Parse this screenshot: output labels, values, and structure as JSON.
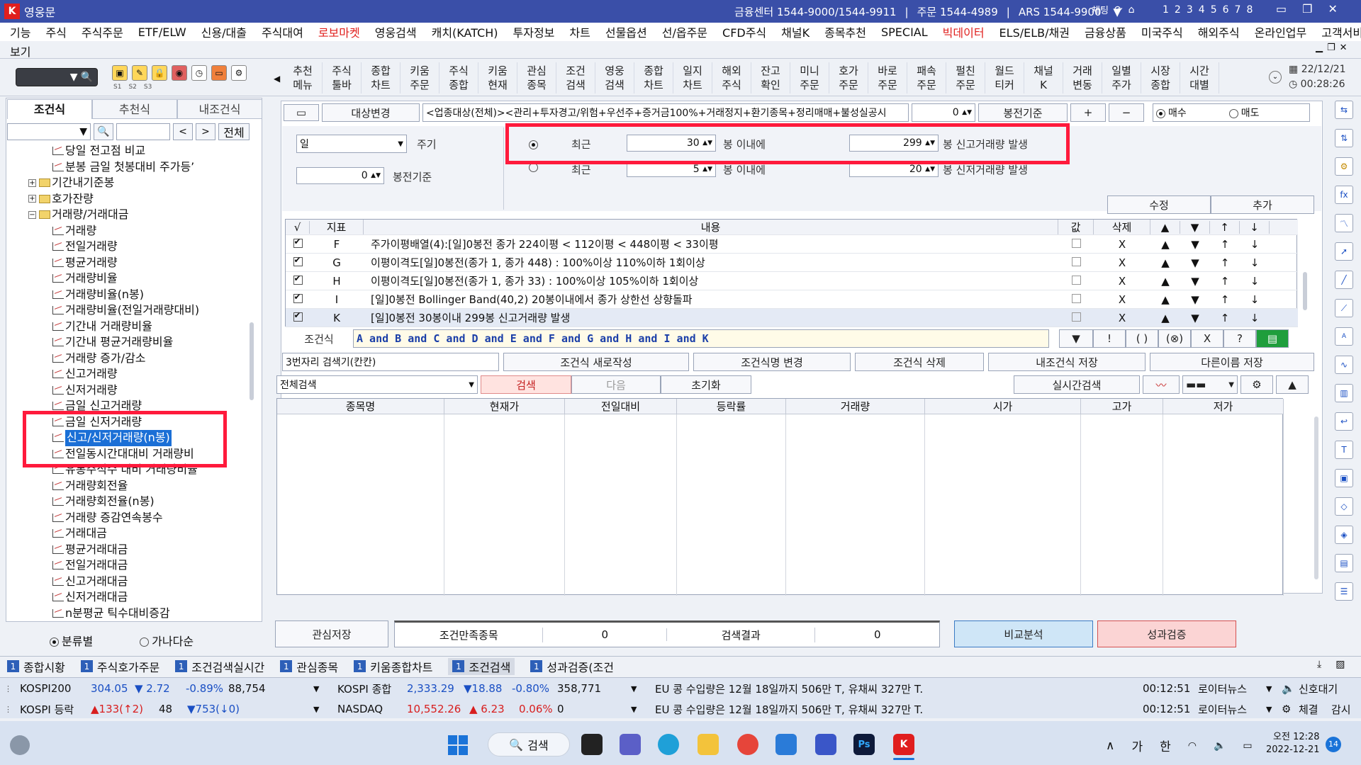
{
  "window": {
    "app_title": "영웅문",
    "info": [
      "금융센터 1544-9000/1544-9911",
      "|",
      "주문 1544-4989",
      "|",
      "ARS 1544-9900"
    ],
    "chat_label": "채팅",
    "screen_nums": [
      "1",
      "2",
      "3",
      "4",
      "5",
      "6",
      "7",
      "8"
    ]
  },
  "menu": [
    "기능",
    "주식",
    "주식주문",
    "ETF/ELW",
    "신용/대출",
    "주식대여",
    "로보마켓",
    "영웅검색",
    "캐치(KATCH)",
    "투자정보",
    "차트",
    "선물옵션",
    "선/옵주문",
    "CFD주식",
    "채널K",
    "종목추천",
    "SPECIAL",
    "빅데이터",
    "ELS/ELB/채권",
    "금융상품",
    "미국주식",
    "해외주식",
    "온라인업무",
    "고객서비스"
  ],
  "menu_red": [
    "로보마켓",
    "빅데이터"
  ],
  "menu_second": "보기",
  "toolbar": {
    "sub_labels": [
      "S1",
      "S2",
      "S3"
    ],
    "grid": [
      "추천\n메뉴",
      "주식\n툴바",
      "종합\n차트",
      "키움\n주문",
      "주식\n종합",
      "키움\n현재",
      "관심\n종목",
      "조건\n검색",
      "영웅\n검색",
      "종합\n차트",
      "일지\n차트",
      "해외\n주식",
      "잔고\n확인",
      "미니\n주문",
      "호가\n주문",
      "바로\n주문",
      "패속\n주문",
      "펄친\n주문",
      "월드\n티커",
      "채널\nK",
      "거래\n변동",
      "일별\n주가",
      "시장\n종합",
      "시간\n대별"
    ],
    "date": "22/12/21",
    "time": "00:28:26"
  },
  "left": {
    "tabs": [
      "조건식",
      "추천식",
      "내조건식"
    ],
    "all_button": "전체",
    "tree": [
      {
        "type": "item",
        "label": "당일 전고점 비교",
        "indent": 2
      },
      {
        "type": "item",
        "label": "분봉 금일 첫봉대비 주가등’",
        "indent": 2
      },
      {
        "type": "folder",
        "label": "기간내기준봉",
        "pm": "+",
        "indent": 0
      },
      {
        "type": "folder",
        "label": "호가잔량",
        "pm": "+",
        "indent": 0
      },
      {
        "type": "folder",
        "label": "거래량/거래대금",
        "pm": "−",
        "indent": 0
      },
      {
        "type": "item",
        "label": "거래량",
        "indent": 2
      },
      {
        "type": "item",
        "label": "전일거래량",
        "indent": 2
      },
      {
        "type": "item",
        "label": "평균거래량",
        "indent": 2
      },
      {
        "type": "item",
        "label": "거래량비율",
        "indent": 2
      },
      {
        "type": "item",
        "label": "거래량비율(n봉)",
        "indent": 2
      },
      {
        "type": "item",
        "label": "거래량비율(전일거래량대비)",
        "indent": 2
      },
      {
        "type": "item",
        "label": "기간내 거래량비율",
        "indent": 2
      },
      {
        "type": "item",
        "label": "기간내 평균거래량비율",
        "indent": 2
      },
      {
        "type": "item",
        "label": "거래량 증가/감소",
        "indent": 2
      },
      {
        "type": "item",
        "label": "신고거래량",
        "indent": 2
      },
      {
        "type": "item",
        "label": "신저거래량",
        "indent": 2
      },
      {
        "type": "item",
        "label": "금일 신고거래량",
        "indent": 2
      },
      {
        "type": "item",
        "label": "금일 신저거래량",
        "indent": 2
      },
      {
        "type": "item",
        "label": "신고/신저거래량(n봉)",
        "indent": 2,
        "selected": true
      },
      {
        "type": "item",
        "label": "전일동시간대대비 거래량비",
        "indent": 2
      },
      {
        "type": "item",
        "label": "유통주식수 대비 거래량비율",
        "indent": 2
      },
      {
        "type": "item",
        "label": "거래량회전율",
        "indent": 2
      },
      {
        "type": "item",
        "label": "거래량회전율(n봉)",
        "indent": 2
      },
      {
        "type": "item",
        "label": "거래량 증감연속봉수",
        "indent": 2
      },
      {
        "type": "item",
        "label": "거래대금",
        "indent": 2
      },
      {
        "type": "item",
        "label": "평균거래대금",
        "indent": 2
      },
      {
        "type": "item",
        "label": "전일거래대금",
        "indent": 2
      },
      {
        "type": "item",
        "label": "신고거래대금",
        "indent": 2
      },
      {
        "type": "item",
        "label": "신저거래대금",
        "indent": 2
      },
      {
        "type": "item",
        "label": "n분평균 틱수대비증감",
        "indent": 2
      }
    ],
    "radio_a": "분류별",
    "radio_b": "가나다순"
  },
  "cond": {
    "target_button": "대상변경",
    "target_text": "<업종대상(전체)><관리+투자경고/위험+우선주+증거금100%+거래정지+환기종목+정리매매+불성실공시",
    "num": "0",
    "bong_label": "봉전기준",
    "plus": "+",
    "minus": "−",
    "buy": "매수",
    "sell": "매도",
    "period_value": "일",
    "period_label": "주기",
    "bong_base_value": "0",
    "bong_base_label": "봉전기준",
    "row1": {
      "label": "최근",
      "n": "30",
      "mid": "봉 이내에",
      "m": "299",
      "tail": "봉 신고거래량 발생"
    },
    "row2": {
      "label": "최근",
      "n": "5",
      "mid": "봉 이내에",
      "m": "20",
      "tail": "봉 신저거래량 발생"
    },
    "edit": "수정",
    "add": "추가"
  },
  "table": {
    "headers": [
      "√",
      "지표",
      "내용",
      "값",
      "삭제",
      "▲",
      "▼",
      "↑",
      "↓"
    ],
    "rows": [
      {
        "id": "F",
        "content": "주가이평배열(4):[일]0봉전 종가 224이평 < 112이평 < 448이평 < 33이평"
      },
      {
        "id": "G",
        "content": "이평이격도[일]0봉전(종가 1, 종가 448) : 100%이상 110%이하 1회이상"
      },
      {
        "id": "H",
        "content": "이평이격도[일]0봉전(종가 1, 종가 33) : 100%이상 105%이하 1회이상"
      },
      {
        "id": "I",
        "content": "[일]0봉전 Bollinger Band(40,2) 20봉이내에서 종가 상한선 상향돌파"
      },
      {
        "id": "K",
        "content": "[일]0봉전 30봉이내 299봉 신고거래량 발생"
      }
    ],
    "del": "X",
    "up": "▲",
    "down": "▼",
    "top": "↑",
    "bottom": "↓",
    "formula_label": "조건식",
    "formula": "A and B and C and D and E and F and G and H and I and K",
    "formula_btns": [
      "▼",
      "!",
      "( )",
      "(⊗)",
      "X",
      "?"
    ]
  },
  "actions": {
    "name_input": "3번자리 검색기(칸칸)",
    "buttons": [
      "조건식 새로작성",
      "조건식명 변경",
      "조건식 삭제",
      "내조건식 저장",
      "다른이름 저장"
    ],
    "scope": "전체검색",
    "search": "검색",
    "next": "다음",
    "reset": "초기화",
    "realtime": "실시간검색"
  },
  "results": {
    "headers": [
      "종목명",
      "현재가",
      "전일대비",
      "등락률",
      "거래량",
      "시가",
      "고가",
      "저가"
    ]
  },
  "bottom": {
    "save_watch": "관심저장",
    "satisfied_label": "조건만족종목",
    "satisfied_val": "0",
    "result_label": "검색결과",
    "result_val": "0",
    "compare": "비교분석",
    "verify": "성과검증"
  },
  "statustabs": [
    {
      "n": "1",
      "label": "종합시황"
    },
    {
      "n": "1",
      "label": "주식호가주문"
    },
    {
      "n": "1",
      "label": "조건검색실시간"
    },
    {
      "n": "1",
      "label": "관심종목"
    },
    {
      "n": "1",
      "label": "키움종합차트"
    },
    {
      "n": "1",
      "label": "조건검색",
      "active": true
    },
    {
      "n": "1",
      "label": "성과검증(조건"
    }
  ],
  "ticker": {
    "r1": {
      "name": "KOSPI200",
      "v": "304.05",
      "d": "▼ 2.72",
      "p": "-0.89%",
      "vol": "88,754",
      "name2": "KOSPI 종합",
      "v2": "2,333.29",
      "d2": "▼18.88",
      "p2": "-0.80%",
      "vol2": "358,771",
      "news": "EU 콩 수입량은 12월 18일까지 506만 T, 유채씨 327만 T.",
      "time": "00:12:51",
      "src": "로이터뉴스",
      "extra": "신호대기"
    },
    "r2": {
      "name": "KOSPI 등락",
      "up": "▲133(↑2)",
      "same": "48",
      "down": "▼753(↓0)",
      "name2": "NASDAQ",
      "v2": "10,552.26",
      "d2": "▲ 6.23",
      "p2": "0.06%",
      "vol2": "0",
      "news": "EU 콩 수입량은 12월 18일까지 506만 T, 유채씨 327만 T.",
      "time": "00:12:51",
      "src": "로이터뉴스",
      "extra": "체결",
      "extra2": "감시"
    }
  },
  "taskbar": {
    "search": "검색",
    "ime_a": "가",
    "ime_b": "한",
    "clock_time": "12:28",
    "clock_ampm": "오전",
    "clock_date": "2022-12-21",
    "badge": "14"
  }
}
